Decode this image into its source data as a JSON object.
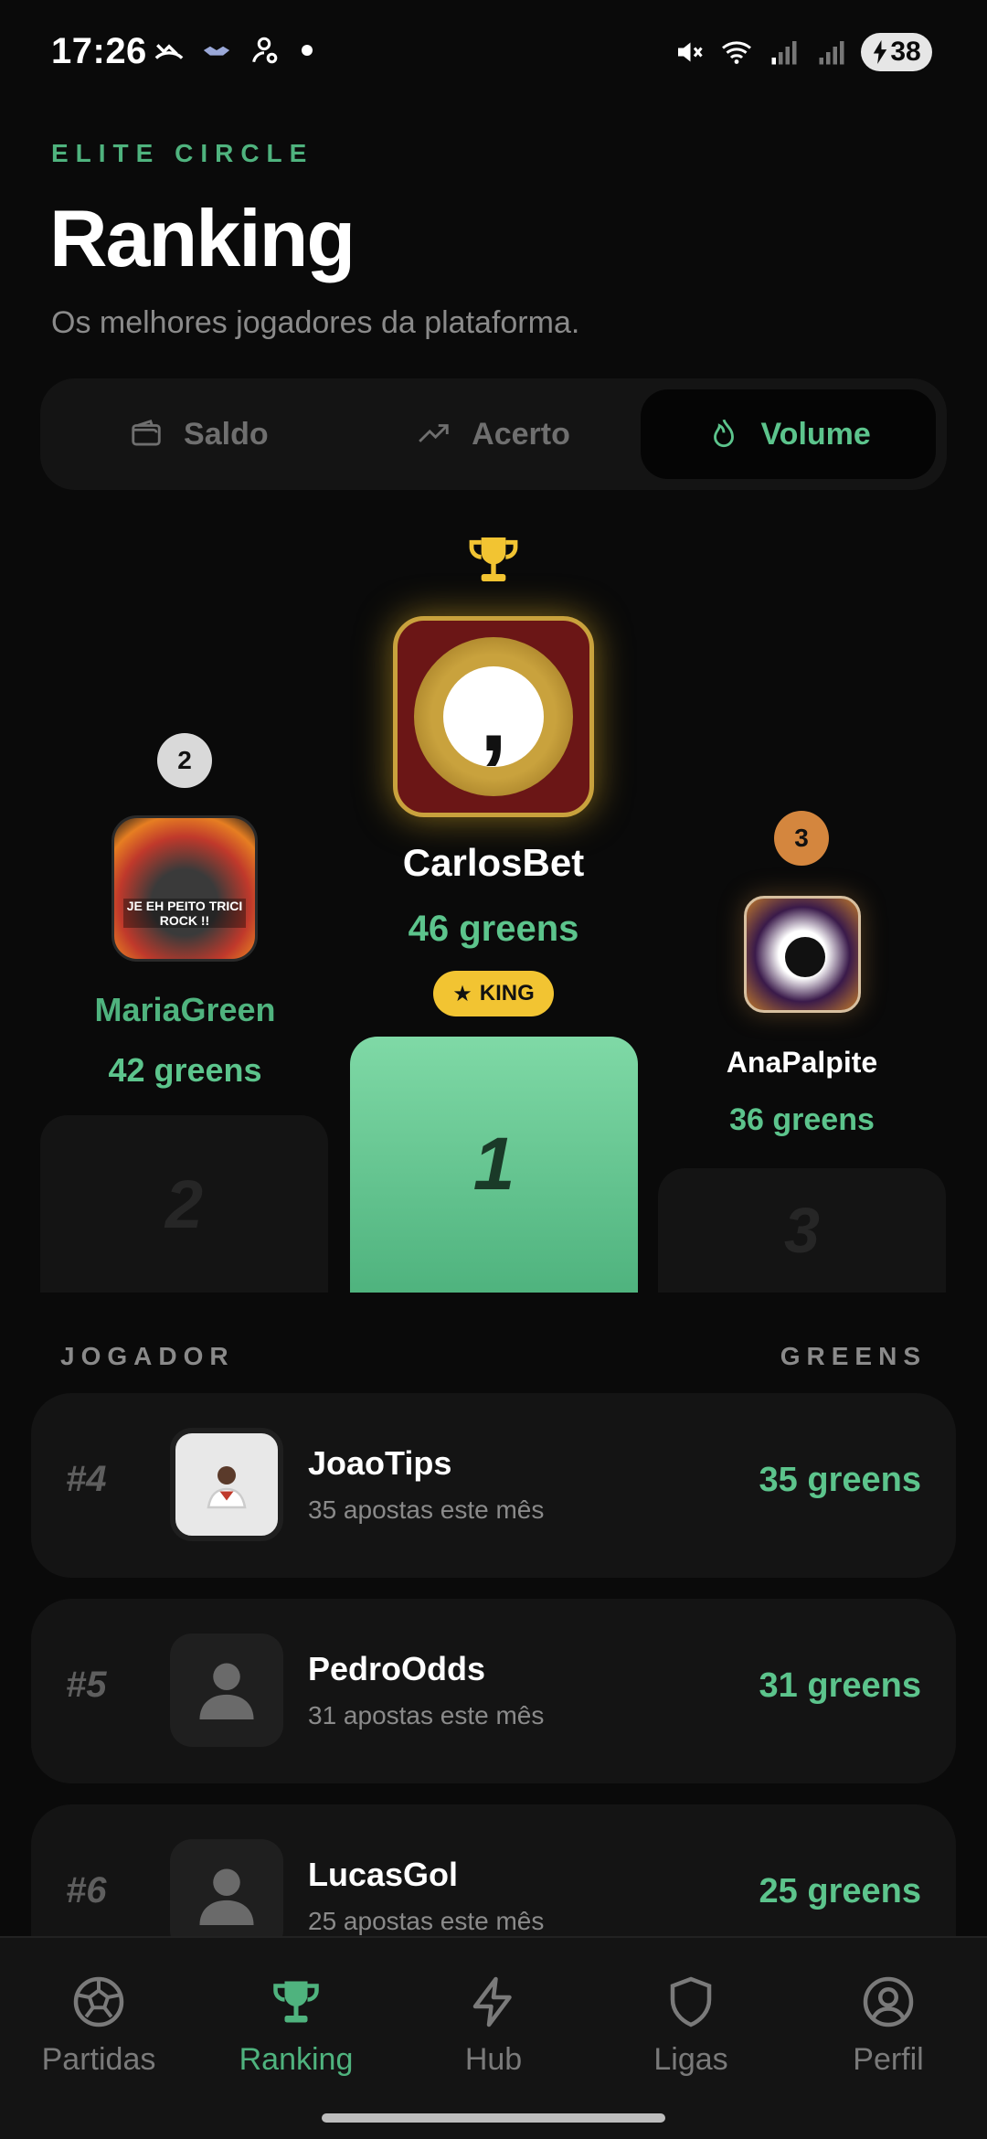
{
  "status_bar": {
    "time": "17:26",
    "battery": "38"
  },
  "header": {
    "eyebrow": "ELITE CIRCLE",
    "title": "Ranking",
    "subtitle": "Os melhores jogadores da plataforma."
  },
  "tabs": [
    {
      "label": "Saldo",
      "icon": "wallet-icon",
      "active": false
    },
    {
      "label": "Acerto",
      "icon": "trend-up-icon",
      "active": false
    },
    {
      "label": "Volume",
      "icon": "flame-icon",
      "active": true
    }
  ],
  "podium": {
    "first": {
      "rank": "1",
      "name": "CarlosBet",
      "greens": "46 greens",
      "badge": "KING",
      "avatar_glyph": ","
    },
    "second": {
      "rank": "2",
      "name": "MariaGreen",
      "greens": "42 greens",
      "avatar_caption": "JE EH PEITO TRICI ROCK !!"
    },
    "third": {
      "rank": "3",
      "name": "AnaPalpite",
      "greens": "36 greens"
    }
  },
  "list": {
    "header_left": "JOGADOR",
    "header_right": "GREENS",
    "rows": [
      {
        "rank": "#4",
        "name": "JoaoTips",
        "sub": "35 apostas este mês",
        "greens": "35 greens",
        "avatar": "photo"
      },
      {
        "rank": "#5",
        "name": "PedroOdds",
        "sub": "31 apostas este mês",
        "greens": "31 greens",
        "avatar": "user-icon"
      },
      {
        "rank": "#6",
        "name": "LucasGol",
        "sub": "25 apostas este mês",
        "greens": "25 greens",
        "avatar": "user-icon"
      }
    ]
  },
  "bottom_nav": [
    {
      "label": "Partidas",
      "icon": "soccer-ball-icon",
      "active": false
    },
    {
      "label": "Ranking",
      "icon": "trophy-icon",
      "active": true
    },
    {
      "label": "Hub",
      "icon": "lightning-icon",
      "active": false
    },
    {
      "label": "Ligas",
      "icon": "shield-icon",
      "active": false
    },
    {
      "label": "Perfil",
      "icon": "user-circle-icon",
      "active": false
    }
  ],
  "colors": {
    "accent": "#5cc48c",
    "gold": "#f2c432",
    "bronze": "#d4863e",
    "silver": "#d9d9d9",
    "background": "#0a0a0a",
    "card": "#141414"
  }
}
